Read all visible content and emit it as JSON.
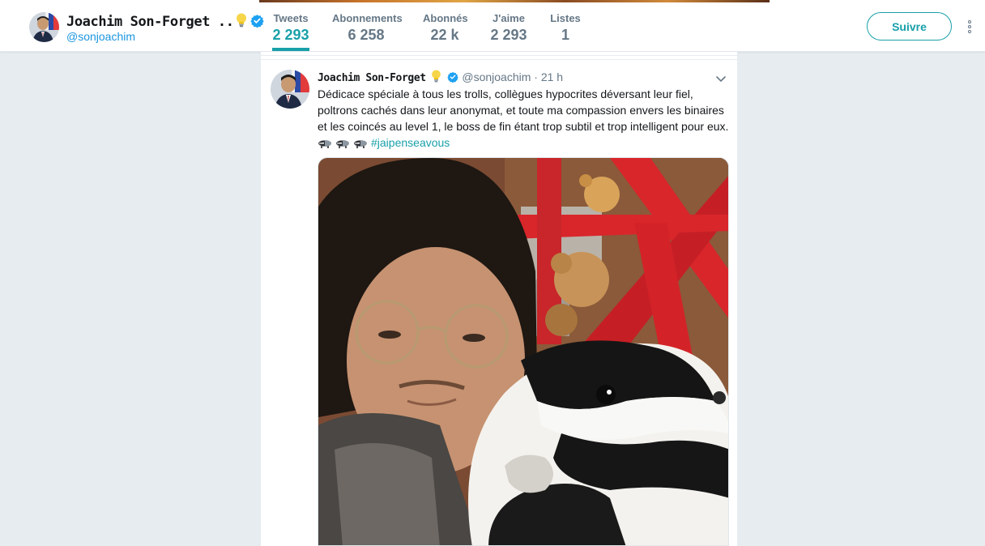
{
  "profile": {
    "name": "Joachim Son-Forget ..",
    "handle": "@sonjoachim"
  },
  "stats": [
    {
      "label": "Tweets",
      "value": "2 293",
      "active": true
    },
    {
      "label": "Abonnements",
      "value": "6 258",
      "active": false
    },
    {
      "label": "Abonnés",
      "value": "22 k",
      "active": false
    },
    {
      "label": "J'aime",
      "value": "2 293",
      "active": false
    },
    {
      "label": "Listes",
      "value": "1",
      "active": false
    }
  ],
  "actions": {
    "follow_label": "Suivre"
  },
  "tweet": {
    "author_name": "Joachim Son-Forget",
    "author_handle": "@sonjoachim",
    "separator": "·",
    "time": "21 h",
    "text": "Dédicace spéciale à tous les trolls, collègues hypocrites déversant leur fiel, poltrons cachés dans leur anonymat, et toute ma compassion envers les binaires et les coincés au level 1, le boss de fin étant trop subtil et trop intelligent pour eux.",
    "hashtag": "#jaipenseavous"
  },
  "icons": {
    "verified": "verified-badge-icon",
    "bulb": "lightbulb-emoji-icon",
    "badger": "badger-emoji-icon",
    "caret": "chevron-down-icon",
    "more": "more-vertical-icon"
  },
  "colors": {
    "accent": "#19a0a9",
    "verified": "#1da1f2",
    "background": "#e6ecf0",
    "text_secondary": "#657786"
  }
}
